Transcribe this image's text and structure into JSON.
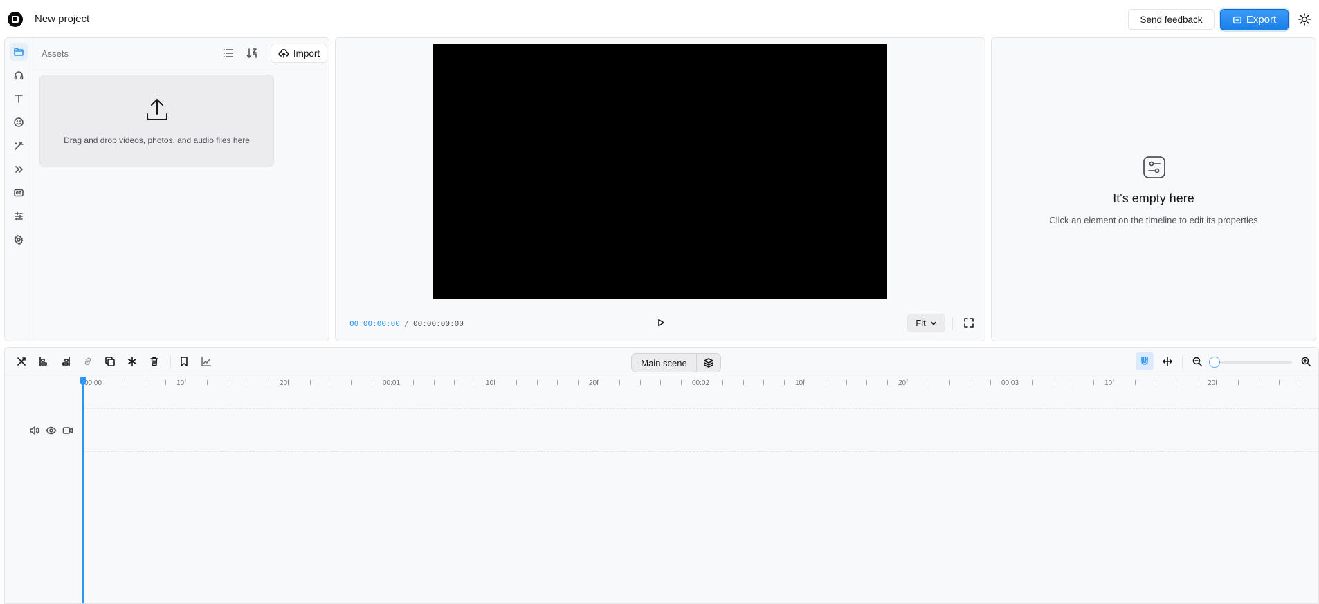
{
  "header": {
    "project_title": "New project",
    "feedback_label": "Send feedback",
    "export_label": "Export"
  },
  "sidebar": {
    "items": [
      {
        "name": "assets",
        "icon": "folder-icon",
        "active": true
      },
      {
        "name": "audio",
        "icon": "headphones-icon"
      },
      {
        "name": "text",
        "icon": "text-icon"
      },
      {
        "name": "stickers",
        "icon": "smile-icon"
      },
      {
        "name": "effects",
        "icon": "magic-wand-icon"
      },
      {
        "name": "transitions",
        "icon": "chevrons-right-icon"
      },
      {
        "name": "captions",
        "icon": "captions-icon"
      },
      {
        "name": "adjust",
        "icon": "sliders-icon"
      },
      {
        "name": "settings",
        "icon": "gear-icon"
      }
    ]
  },
  "assets": {
    "title": "Assets",
    "import_label": "Import",
    "drop_text": "Drag and drop videos, photos, and audio files here"
  },
  "preview": {
    "current_time": "00:00:00:00",
    "separator": "/",
    "total_time": "00:00:00:00",
    "fit_label": "Fit"
  },
  "properties": {
    "empty_title": "It's empty here",
    "empty_subtitle": "Click an element on the timeline to edit its properties"
  },
  "timeline": {
    "scene_label": "Main scene",
    "ruler": {
      "labels": [
        "00:00",
        "10f",
        "20f",
        "00:01",
        "10f",
        "20f",
        "00:02",
        "10f",
        "20f",
        "00:03",
        "10f",
        "20f"
      ]
    },
    "toolbar_icons": [
      "split-icon",
      "align-start-icon",
      "align-end-icon",
      "link-icon",
      "duplicate-icon",
      "freeze-icon",
      "trash-icon",
      "bookmark-icon",
      "graph-icon"
    ],
    "snap_enabled": true
  },
  "colors": {
    "accent": "#2f95f0",
    "export_button": "#1a7fe8",
    "canvas": "#000000",
    "panel_bg": "#f8f9fa"
  }
}
